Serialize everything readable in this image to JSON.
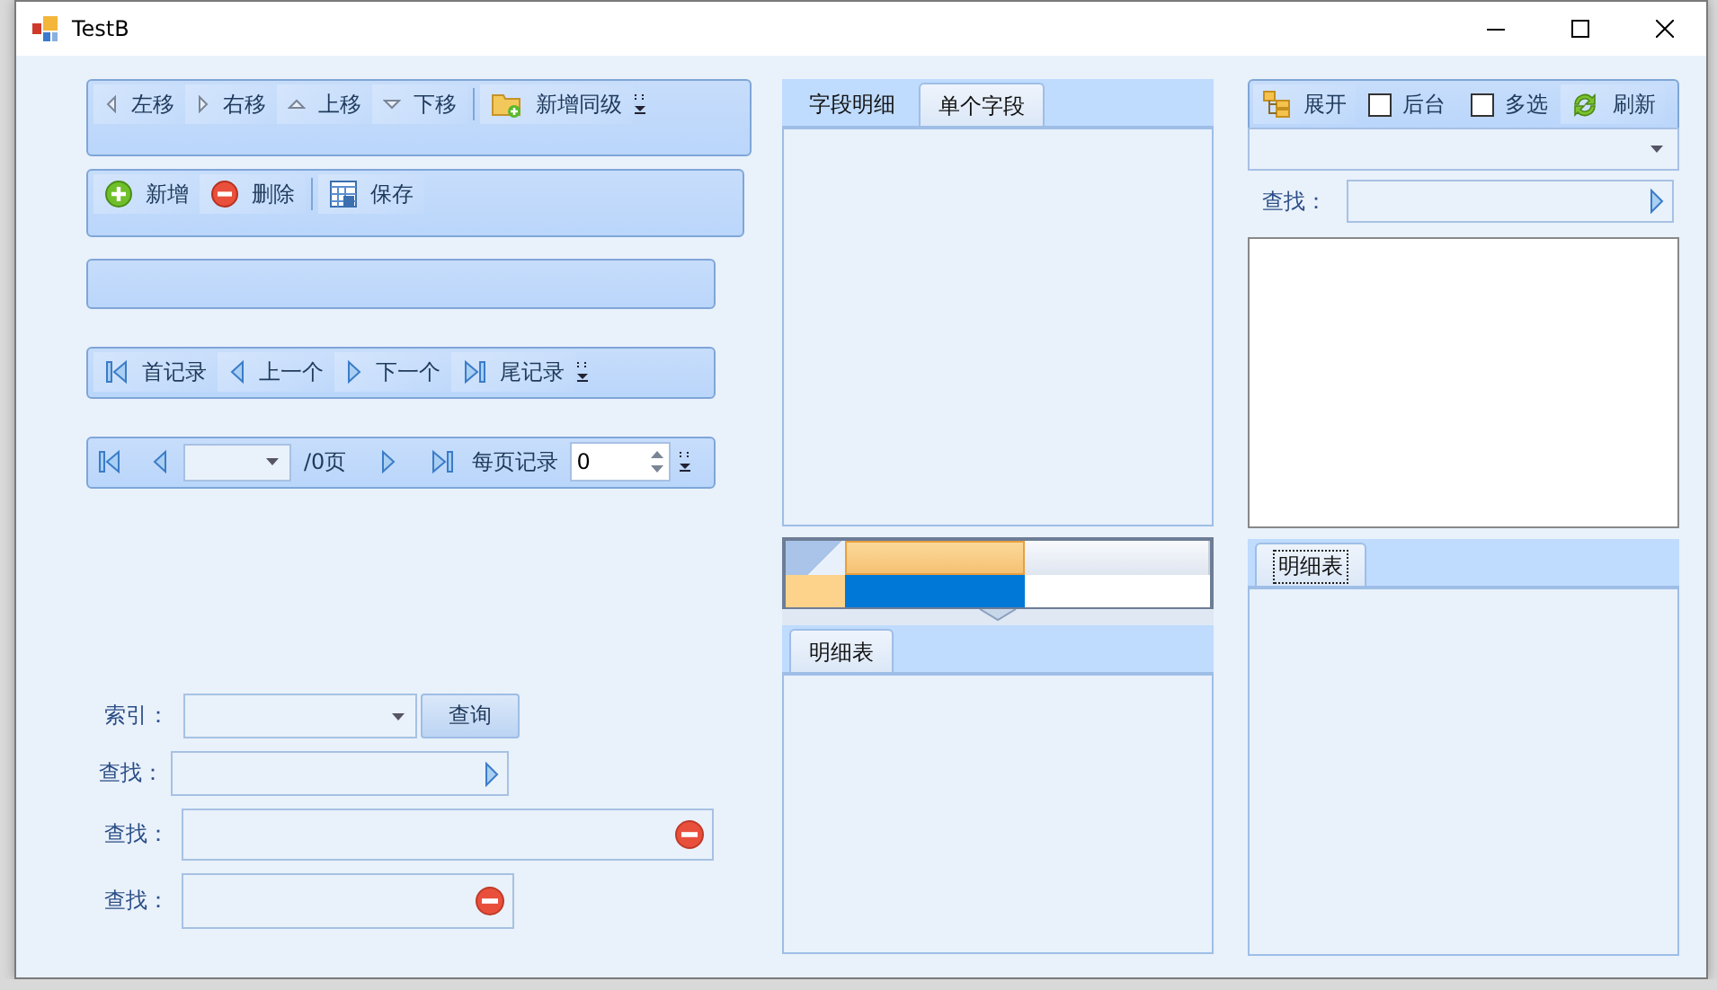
{
  "window": {
    "title": "TestB"
  },
  "move_toolbar": {
    "items": [
      {
        "kind": "left",
        "label": "左移"
      },
      {
        "kind": "right",
        "label": "右移"
      },
      {
        "kind": "up",
        "label": "上移"
      },
      {
        "kind": "down",
        "label": "下移"
      },
      {
        "kind": "folder-add",
        "label": "新增同级"
      }
    ]
  },
  "edit_toolbar": {
    "items": [
      {
        "kind": "add",
        "label": "新增"
      },
      {
        "kind": "delete",
        "label": "删除"
      },
      {
        "kind": "save",
        "label": "保存"
      }
    ]
  },
  "record_navigator": {
    "items": [
      {
        "kind": "first",
        "label": "首记录"
      },
      {
        "kind": "prev",
        "label": "上一个"
      },
      {
        "kind": "next",
        "label": "下一个"
      },
      {
        "kind": "last",
        "label": "尾记录"
      }
    ]
  },
  "pager": {
    "page_total": "/0页",
    "page_size_label": "每页记录",
    "page_size": "0"
  },
  "search_form": {
    "index_label": "索引：",
    "query_button": "查询",
    "search_rows": [
      {
        "label": "查找：",
        "kind": "go"
      },
      {
        "label": "查找：",
        "kind": "clear"
      },
      {
        "label": "查找：",
        "kind": "clear"
      }
    ]
  },
  "field_tabs": {
    "tabs": [
      {
        "label": "字段明细",
        "selected": false
      },
      {
        "label": "单个字段",
        "selected": true
      }
    ]
  },
  "left_detail_tabs": {
    "tabs": [
      {
        "label": "明细表",
        "selected": true,
        "focused": false
      }
    ]
  },
  "tree_toolbar": {
    "expand": "展开",
    "checkboxes": [
      {
        "label": "后台",
        "checked": false
      },
      {
        "label": "多选",
        "checked": false
      }
    ],
    "refresh": "刷新"
  },
  "tree_search": {
    "label": "查找："
  },
  "right_detail_tabs": {
    "tabs": [
      {
        "label": "明细表",
        "selected": true,
        "focused": true
      }
    ]
  }
}
